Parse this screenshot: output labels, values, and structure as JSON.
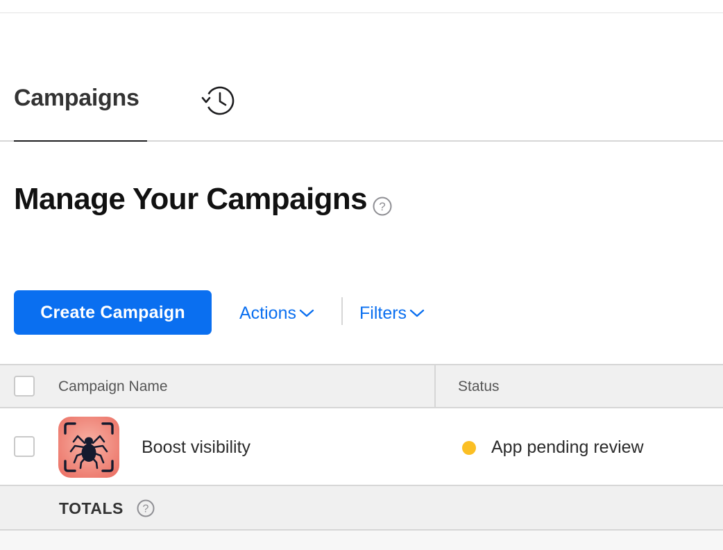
{
  "tabs": {
    "campaigns_label": "Campaigns",
    "history_icon": "history-clock-icon"
  },
  "page": {
    "title": "Manage Your Campaigns",
    "help_icon": "question-circle-icon"
  },
  "toolbar": {
    "create_label": "Create Campaign",
    "actions_label": "Actions",
    "filters_label": "Filters",
    "dropdown_icon": "chevron-down-icon"
  },
  "table": {
    "columns": [
      "Campaign Name",
      "Status"
    ],
    "rows": [
      {
        "name": "Boost visibility",
        "status": "App pending review",
        "status_color": "#fbbf24",
        "app_icon": "spider-app-icon"
      }
    ],
    "totals_label": "TOTALS"
  },
  "colors": {
    "accent": "#0a6ff0",
    "header_bg": "#f0f0f0",
    "border": "#d6d6d6"
  }
}
